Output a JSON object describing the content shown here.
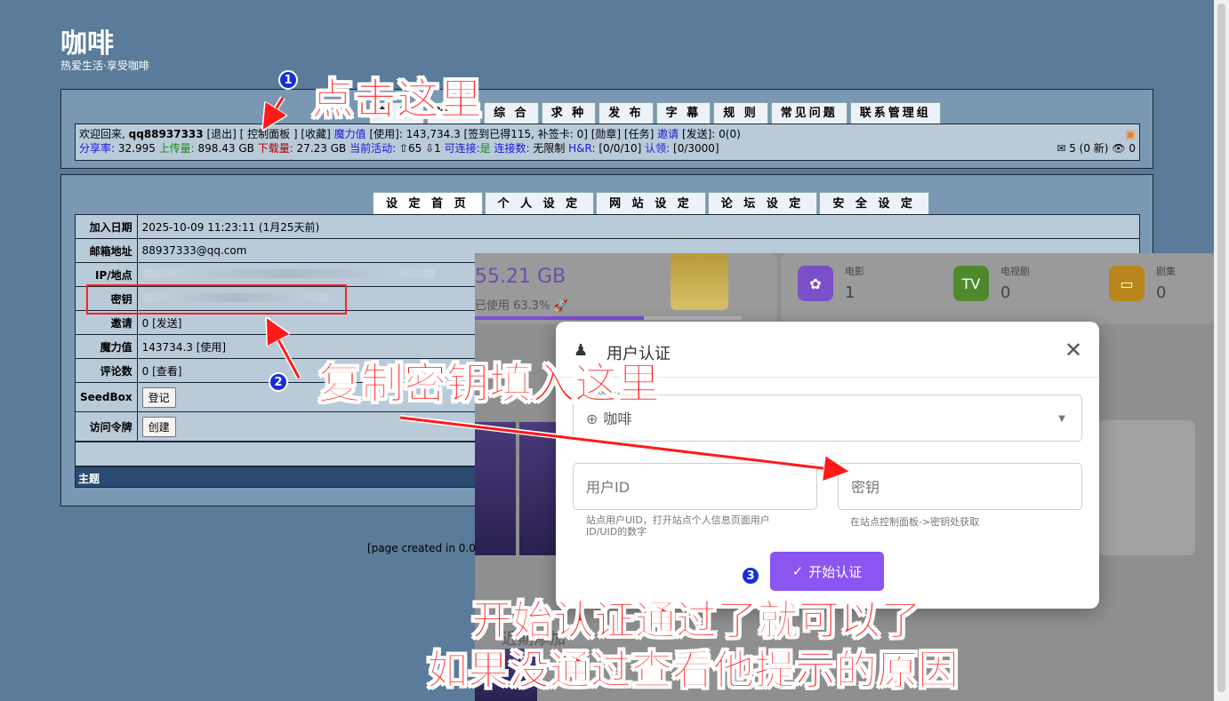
{
  "site": {
    "title": "咖啡",
    "slogan": "热爱生活·享受咖啡"
  },
  "nav": [
    "首 页",
    "论 坛",
    "综 合",
    "求 种",
    "发 布",
    "字 幕",
    "规 则",
    "常见问题",
    "联系管理组"
  ],
  "infobar": {
    "line1": "欢迎回来, ",
    "username": "qq88937333",
    "line1b": " [退出] [ 控制面板 ] [收藏] ",
    "magic_label": "魔力值",
    "magic": " [使用]: 143,734.3 [签到已得115, 补签卡: 0] [勋章] [任务] ",
    "invite": "邀请",
    "sent": " [发送]: 0(0)",
    "ratio_label": "分享率:",
    "ratio": " 32.995 ",
    "up_label": "上传量:",
    "up": " 898.43 GB ",
    "down_label": "下载量:",
    "down": " 27.23 GB ",
    "active_label": "当前活动:",
    "active": " ⇧65 ⇩1 ",
    "conn_label": "可连接:",
    "conn": "是",
    "conns_label": " 连接数:",
    "conns": " 无限制 ",
    "hr_label": "H&R:",
    "hr": " [0/0/10] ",
    "claim_label": "认领:",
    "claim": " [0/3000]",
    "messages": "✉ 5 (0 新) 👁 0"
  },
  "subnav": [
    "设 定 首 页",
    "个 人 设 定",
    "网 站 设 定",
    "论 坛 设 定",
    "安 全 设 定"
  ],
  "rows": [
    {
      "label": "加入日期",
      "value": "2025-10-09 11:23:11 (1月25天前)"
    },
    {
      "label": "邮箱地址",
      "value": "88937333@qq.com"
    },
    {
      "label": "IP/地点",
      "value": ""
    },
    {
      "label": "密钥",
      "value": ""
    },
    {
      "label": "邀请",
      "value": "0 [发送]"
    },
    {
      "label": "魔力值",
      "value": "143734.3 [使用]"
    },
    {
      "label": "评论数",
      "value": "0 [查看]"
    },
    {
      "label": "SeedBox",
      "button": "登记"
    },
    {
      "label": "访问令牌",
      "button": "创建"
    }
  ],
  "topic": "主题",
  "page_created": "[page created in 0.057",
  "overlay": {
    "storage": "55.21 GB",
    "used": "已使用 63.3% 🚀",
    "stats": [
      {
        "label": "电影",
        "value": "1",
        "color": "#8b5cf6"
      },
      {
        "label": "电视剧",
        "value": "0",
        "color": "#4caf50"
      },
      {
        "label": "剧集",
        "value": "0",
        "color": "#e6a817"
      }
    ],
    "bottom_text": "近期添加"
  },
  "modal": {
    "title": "用户认证",
    "site_label": "选择站点",
    "site": "咖啡",
    "uid_placeholder": "用户ID",
    "key_placeholder": "密钥",
    "uid_hint": "站点用户UID，打开站点个人信息页面用户ID/UID的数字",
    "key_hint": "在站点控制面板->密钥处获取",
    "start": "开始认证"
  },
  "annotations": {
    "a1": "点击这里",
    "a2": "复制密钥填入这里",
    "a3": "开始认证通过了就可以了",
    "a4": "如果没通过查看他提示的原因",
    "n1": "1",
    "n2": "2",
    "n3": "3"
  }
}
